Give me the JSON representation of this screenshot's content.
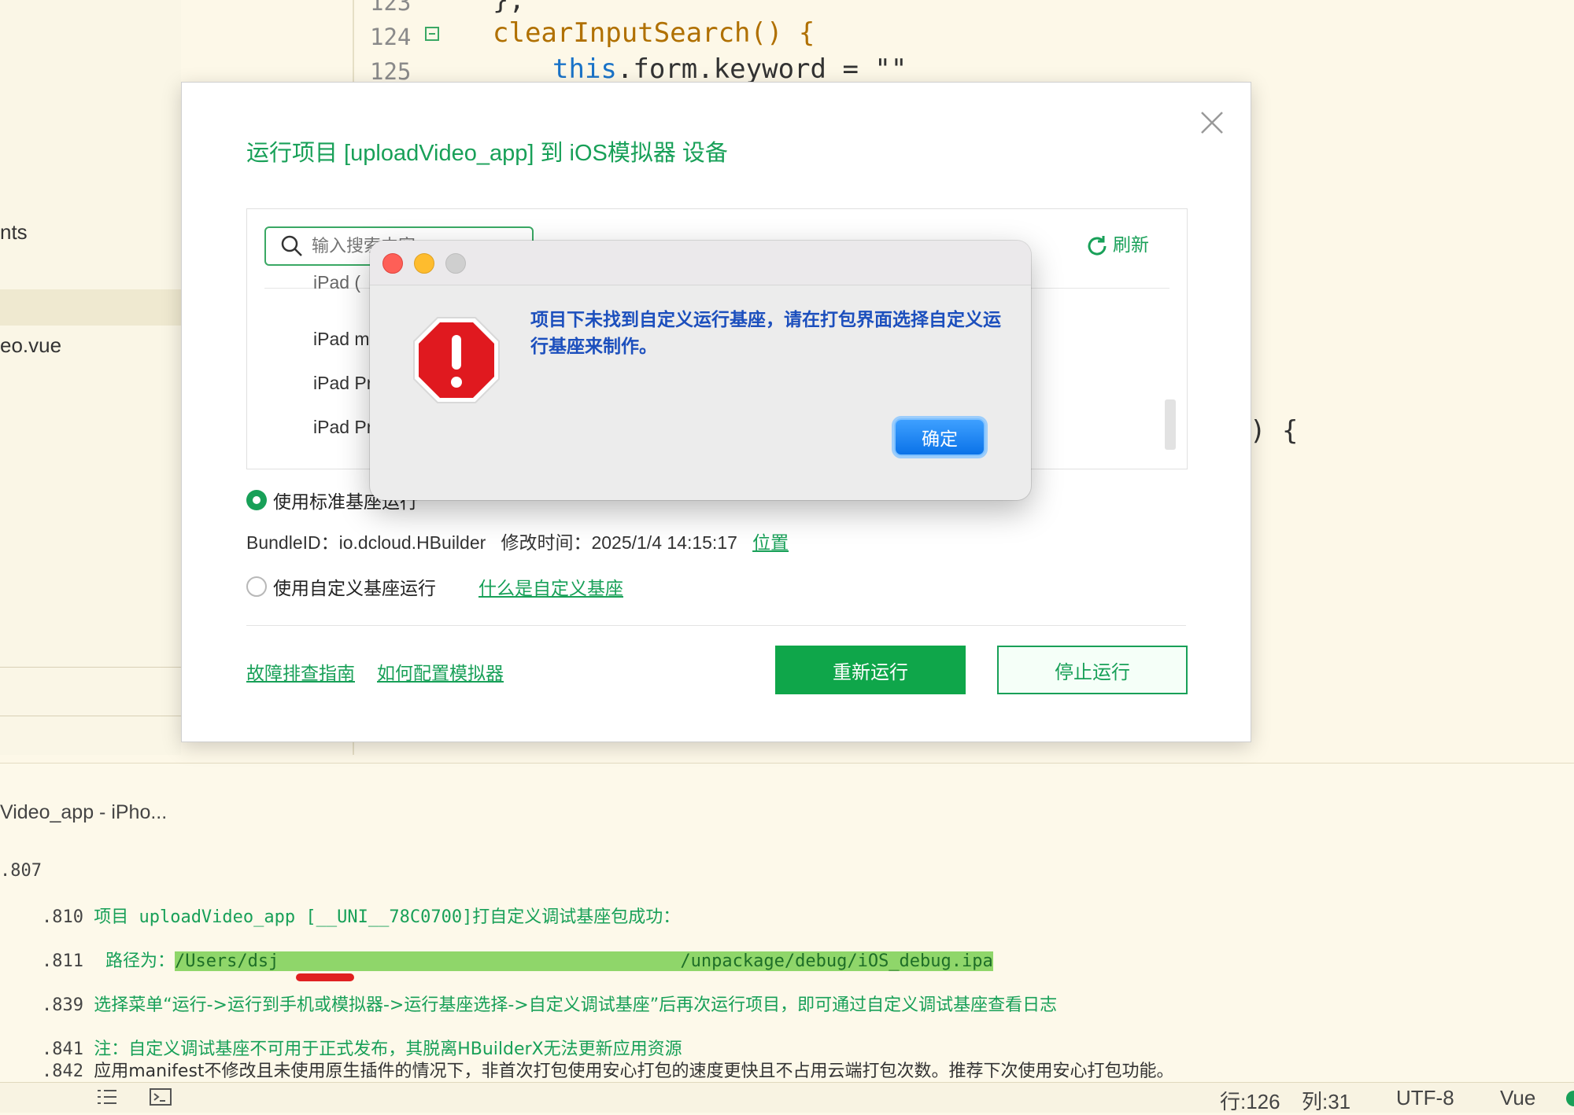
{
  "sidebar": {
    "items": [
      {
        "label": "nts"
      },
      {
        "label": "eo.vue"
      }
    ]
  },
  "editor": {
    "lines": [
      {
        "number": "123",
        "code": "};"
      },
      {
        "number": "124",
        "code": "clearInputSearch() {"
      },
      {
        "number": "125",
        "code_this": "this",
        "code_rest": ".form.keyword = \"\""
      }
    ],
    "partial_code": ") {"
  },
  "run_dialog": {
    "title": "运行项目 [uploadVideo_app] 到 iOS模拟器 设备",
    "search_placeholder": "输入搜索内容",
    "refresh_label": "刷新",
    "devices": [
      "iPad (",
      "iPad m",
      "iPad Pr",
      "iPad Pr"
    ],
    "standard_base_label": "使用标准基座运行",
    "bundle_id_text": "BundleID：io.dcloud.HBuilder",
    "modified_time_text": "修改时间：2025/1/4 14:15:17",
    "location_link": "位置",
    "custom_base_label": "使用自定义基座运行",
    "what_is_custom_link": "什么是自定义基座",
    "troubleshoot_link": "故障排查指南",
    "configure_simulator_link": "如何配置模拟器",
    "rerun_button": "重新运行",
    "stop_button": "停止运行"
  },
  "alert": {
    "message": "项目下未找到自定义运行基座，请在打包界面选择自定义运行基座来制作。",
    "ok_button": "确定"
  },
  "console": {
    "tab_title": "Video_app - iPho...",
    "lines": [
      {
        "time": ".807",
        "text": ""
      },
      {
        "time": ".810",
        "text": "项目 uploadVideo_app [__UNI__78C0700]打自定义调试基座包成功："
      },
      {
        "time": ".811",
        "label": "    路径为：",
        "path_start": "/Users/dsj",
        "path_end": "/unpackage/debug/iOS_debug.ipa"
      },
      {
        "time": ".839",
        "text": "选择菜单“运行->运行到手机或模拟器->运行基座选择->自定义调试基座”后再次运行项目，即可通过自定义调试基座查看日志"
      },
      {
        "time": ".841",
        "text": "注：自定义调试基座不可用于正式发布，其脱离HBuilderX无法更新应用资源"
      },
      {
        "time": ".842",
        "text": "应用manifest不修改且未使用原生插件的情况下，非首次打包使用安心打包的速度更快且不占用云端打包次数。推荐下次使用安心打包功能。"
      }
    ]
  },
  "statusbar": {
    "line": "行:126",
    "column": "列:31",
    "encoding": "UTF-8",
    "language": "Vue"
  },
  "colors": {
    "accent_green": "#18a058",
    "alert_text_blue": "#1c4fbd",
    "close_red": "#fe5f57",
    "minimize_yellow": "#febc2e",
    "zoom_gray": "#cfcfcf"
  },
  "icons": [
    "search-icon",
    "refresh-icon",
    "close-icon",
    "error-stop-icon",
    "fold-icon"
  ]
}
